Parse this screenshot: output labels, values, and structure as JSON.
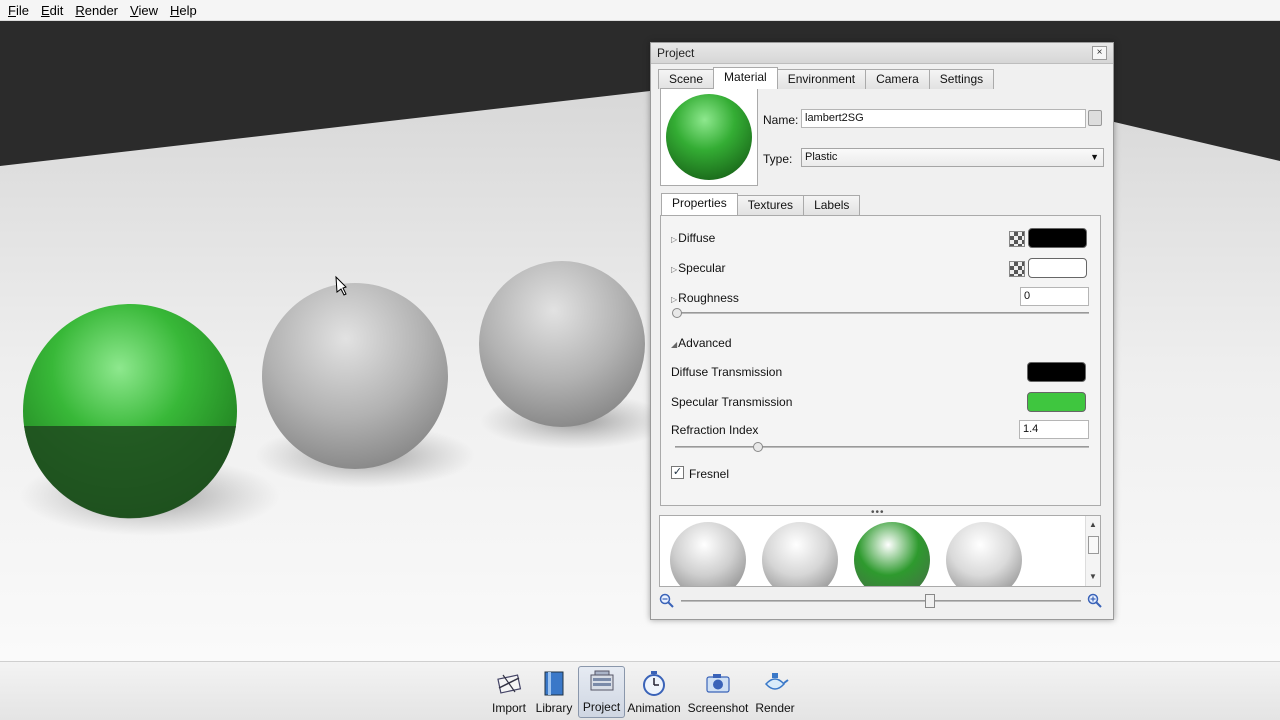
{
  "menu": [
    "File",
    "Edit",
    "Render",
    "View",
    "Help"
  ],
  "project_window": {
    "title": "Project",
    "close_glyph": "×",
    "tabs": [
      "Scene",
      "Material",
      "Environment",
      "Camera",
      "Settings"
    ],
    "active_tab": "Material",
    "material": {
      "name_label": "Name:",
      "name_value": "lambert2SG",
      "type_label": "Type:",
      "type_value": "Plastic",
      "preview_color": "#2e9a2e"
    },
    "sub_tabs": [
      "Properties",
      "Textures",
      "Labels"
    ],
    "active_sub_tab": "Properties",
    "properties": {
      "diffuse_label": "Diffuse",
      "diffuse_color": "#000000",
      "specular_label": "Specular",
      "specular_color": "#ffffff",
      "roughness_label": "Roughness",
      "roughness_value": "0",
      "roughness_level": 0,
      "advanced_label": "Advanced",
      "diffuse_transmission_label": "Diffuse Transmission",
      "diffuse_transmission_color": "#000000",
      "specular_transmission_label": "Specular Transmission",
      "specular_transmission_color": "#3fc63f",
      "refraction_index_label": "Refraction Index",
      "refraction_index_value": "1.4",
      "fresnel_label": "Fresnel",
      "fresnel_checked": true
    },
    "grip_glyph": "•••",
    "library_swatches": [
      "#cfcfcf",
      "#d6d6d6",
      "#2e9a2e",
      "#dadada"
    ]
  },
  "toolbar": [
    {
      "label": "Import",
      "icon": "import-icon"
    },
    {
      "label": "Library",
      "icon": "library-icon"
    },
    {
      "label": "Project",
      "icon": "project-icon",
      "active": true
    },
    {
      "label": "Animation",
      "icon": "animation-icon"
    },
    {
      "label": "Screenshot",
      "icon": "screenshot-icon"
    },
    {
      "label": "Render",
      "icon": "render-icon"
    }
  ]
}
